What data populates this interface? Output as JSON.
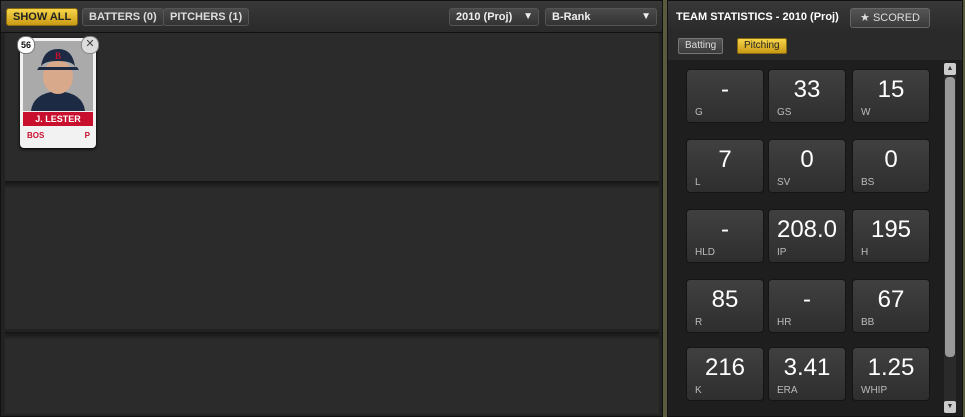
{
  "filter_bar": {
    "buttons": [
      "SHOW ALL",
      "BATTERS (0)",
      "PITCHERS (1)"
    ],
    "season_select": "2010 (Proj)",
    "rank_select": "B-Rank"
  },
  "player_card": {
    "rank": "56",
    "name": "J. LESTER",
    "team": "BOS",
    "position": "P",
    "team_color": "#c8102e"
  },
  "team_stats": {
    "title": "TEAM STATISTICS - 2010 (Proj)",
    "scored_label": "SCORED",
    "tabs": [
      "Batting",
      "Pitching"
    ],
    "active_tab": "Pitching",
    "stats": [
      {
        "value": "-",
        "label": "G"
      },
      {
        "value": "33",
        "label": "GS"
      },
      {
        "value": "15",
        "label": "W"
      },
      {
        "value": "7",
        "label": "L"
      },
      {
        "value": "0",
        "label": "SV"
      },
      {
        "value": "0",
        "label": "BS"
      },
      {
        "value": "-",
        "label": "HLD"
      },
      {
        "value": "208.0",
        "label": "IP"
      },
      {
        "value": "195",
        "label": "H"
      },
      {
        "value": "85",
        "label": "R"
      },
      {
        "value": "-",
        "label": "HR"
      },
      {
        "value": "67",
        "label": "BB"
      },
      {
        "value": "216",
        "label": "K"
      },
      {
        "value": "3.41",
        "label": "ERA"
      },
      {
        "value": "1.25",
        "label": "WHIP"
      }
    ]
  }
}
